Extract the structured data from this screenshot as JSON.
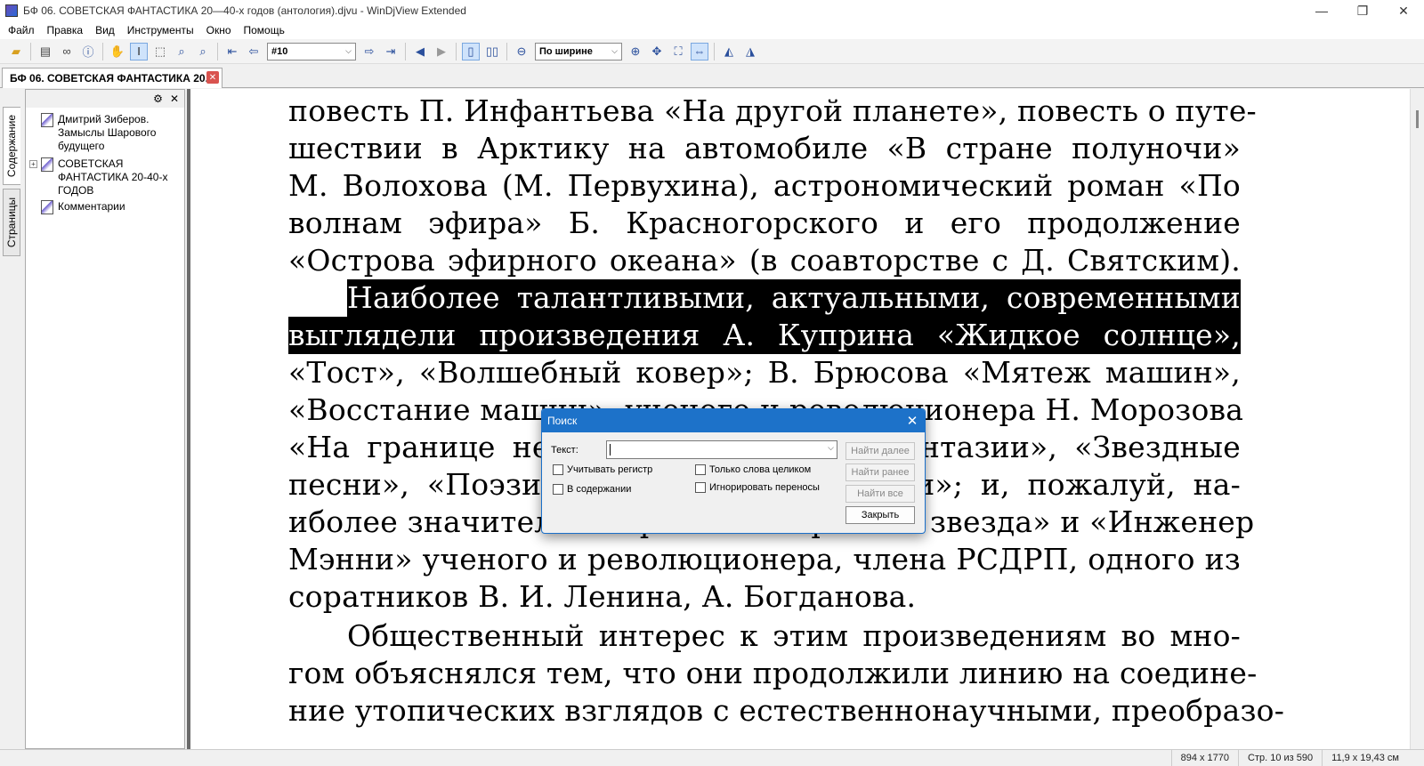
{
  "window": {
    "title": "БФ 06. СОВЕТСКАЯ ФАНТАСТИКА 20—40-х годов (антология).djvu - WinDjView Extended",
    "minimize": "—",
    "restore": "❐",
    "close": "✕"
  },
  "menu": [
    "Файл",
    "Правка",
    "Вид",
    "Инструменты",
    "Окно",
    "Помощь"
  ],
  "toolbar": {
    "page_combo": "#10",
    "zoom_combo": "По ширине",
    "icons": {
      "open": "open-folder-icon",
      "print": "print-icon",
      "find": "binoculars-icon",
      "info": "info-icon",
      "hand": "hand-icon",
      "select": "text-select-icon",
      "rect_select": "rect-select-icon",
      "zoom_in_tool": "magnifier-plus-icon",
      "zoom_out_tool": "magnifier-minus-icon",
      "first": "first-page-icon",
      "prev": "prev-page-icon",
      "next": "next-page-icon",
      "last": "last-page-icon",
      "back": "back-icon",
      "forward": "forward-icon",
      "continuous": "continuous-layout-icon",
      "facing": "facing-pages-icon",
      "zoom_out": "zoom-out-icon",
      "zoom_in": "zoom-in-icon",
      "fit_page": "fit-page-icon",
      "actual": "actual-size-icon",
      "fit_width": "fit-width-icon",
      "rotate_left": "rotate-left-icon",
      "rotate_right": "rotate-right-icon"
    }
  },
  "tab": {
    "label": "БФ 06. СОВЕТСКАЯ ФАНТАСТИКА 20...",
    "close": "✕"
  },
  "side_tabs": {
    "contents": "Содержание",
    "pages": "Страницы"
  },
  "panel": {
    "settings": "⚙",
    "close": "✕",
    "tree": [
      {
        "label": "Дмитрий Зиберов. Замыслы Шарового будущего",
        "expandable": false
      },
      {
        "label": "СОВЕТСКАЯ ФАНТАСТИКА 20-40-х ГОДОВ",
        "expandable": true,
        "expander": "+"
      },
      {
        "label": "Комментарии",
        "expandable": false
      }
    ]
  },
  "document": {
    "lines": [
      "повесть П. Инфантьева «На другой планете», повесть о путе-",
      "шествии в Арктику на автомобиле «В стране полуночи»",
      "М. Волохова (М. Первухина), астрономический роман «По",
      "волнам эфира» Б. Красногорского и его продолжение",
      "«Острова эфирного океана» (в соавторстве с Д. Святским).",
      "Наиболее талантливыми, актуальными, современными",
      "выглядели произведения А. Куприна «Жидкое солнце»,",
      "«Тост», «Волшебный ковер»; В. Брюсова «Мятеж машин»,",
      "«Восстание машин», ученого и революционера Н. Морозова",
      "«На границе неведомого. Научные фантазии», «Звездные",
      "песни», «Поэзия мировых катастрофии»; и, пожалуй, на-",
      "иболее значительные романы «Красная звезда» и «Инженер",
      "Мэнни» ученого и революционера, члена РСДРП, одного из",
      "соратников В. И. Ленина, А. Богданова.",
      "Общественный интерес к этим произведениям во мно-",
      "гом объяснялся тем, что они продолжили линию на соедине-",
      "ние утопических взглядов с естественнонаучными, преобразо-"
    ],
    "highlight_color": "#000000"
  },
  "search_dialog": {
    "title": "Поиск",
    "close": "✕",
    "text_label": "Текст:",
    "text_value": "",
    "checkboxes": {
      "match_case": "Учитывать регистр",
      "whole_words": "Только слова целиком",
      "in_contents": "В содержании",
      "ignore_hyphens": "Игнорировать переносы"
    },
    "buttons": {
      "find_next": "Найти далее",
      "find_prev": "Найти ранее",
      "find_all": "Найти все",
      "close": "Закрыть"
    }
  },
  "status": {
    "size": "894 x 1770",
    "page": "Стр. 10 из 590",
    "dimensions": "11,9 x 19,43 см"
  },
  "colors": {
    "dialog_title": "#1d72c9",
    "close_tab": "#d9534f"
  }
}
